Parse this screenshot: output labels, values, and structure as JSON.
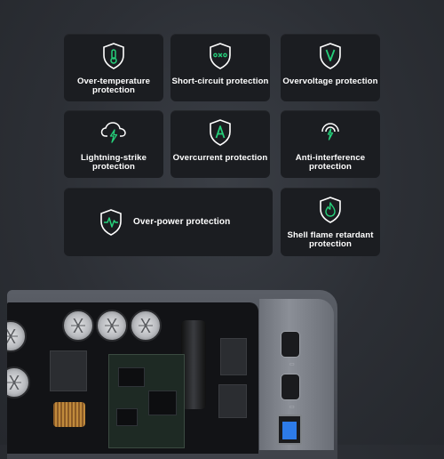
{
  "features": [
    {
      "label": "Over-temperature protection",
      "icon": "thermometer-shield-icon"
    },
    {
      "label": "Short-circuit protection",
      "icon": "short-circuit-shield-icon"
    },
    {
      "label": "Overvoltage protection",
      "icon": "voltage-shield-icon"
    },
    {
      "label": "Lightning-strike protection",
      "icon": "lightning-cloud-icon"
    },
    {
      "label": "Overcurrent protection",
      "icon": "current-shield-icon"
    },
    {
      "label": "Anti-interference protection",
      "icon": "signal-lightning-icon"
    },
    {
      "label": "Over-power protection",
      "icon": "pulse-shield-icon"
    },
    {
      "label": "Shell flame retardant protection",
      "icon": "flame-shield-icon"
    }
  ],
  "colors": {
    "accent": "#25d07a",
    "card": "#1b1d21",
    "text": "#ffffff",
    "background": "#2c2f35"
  }
}
